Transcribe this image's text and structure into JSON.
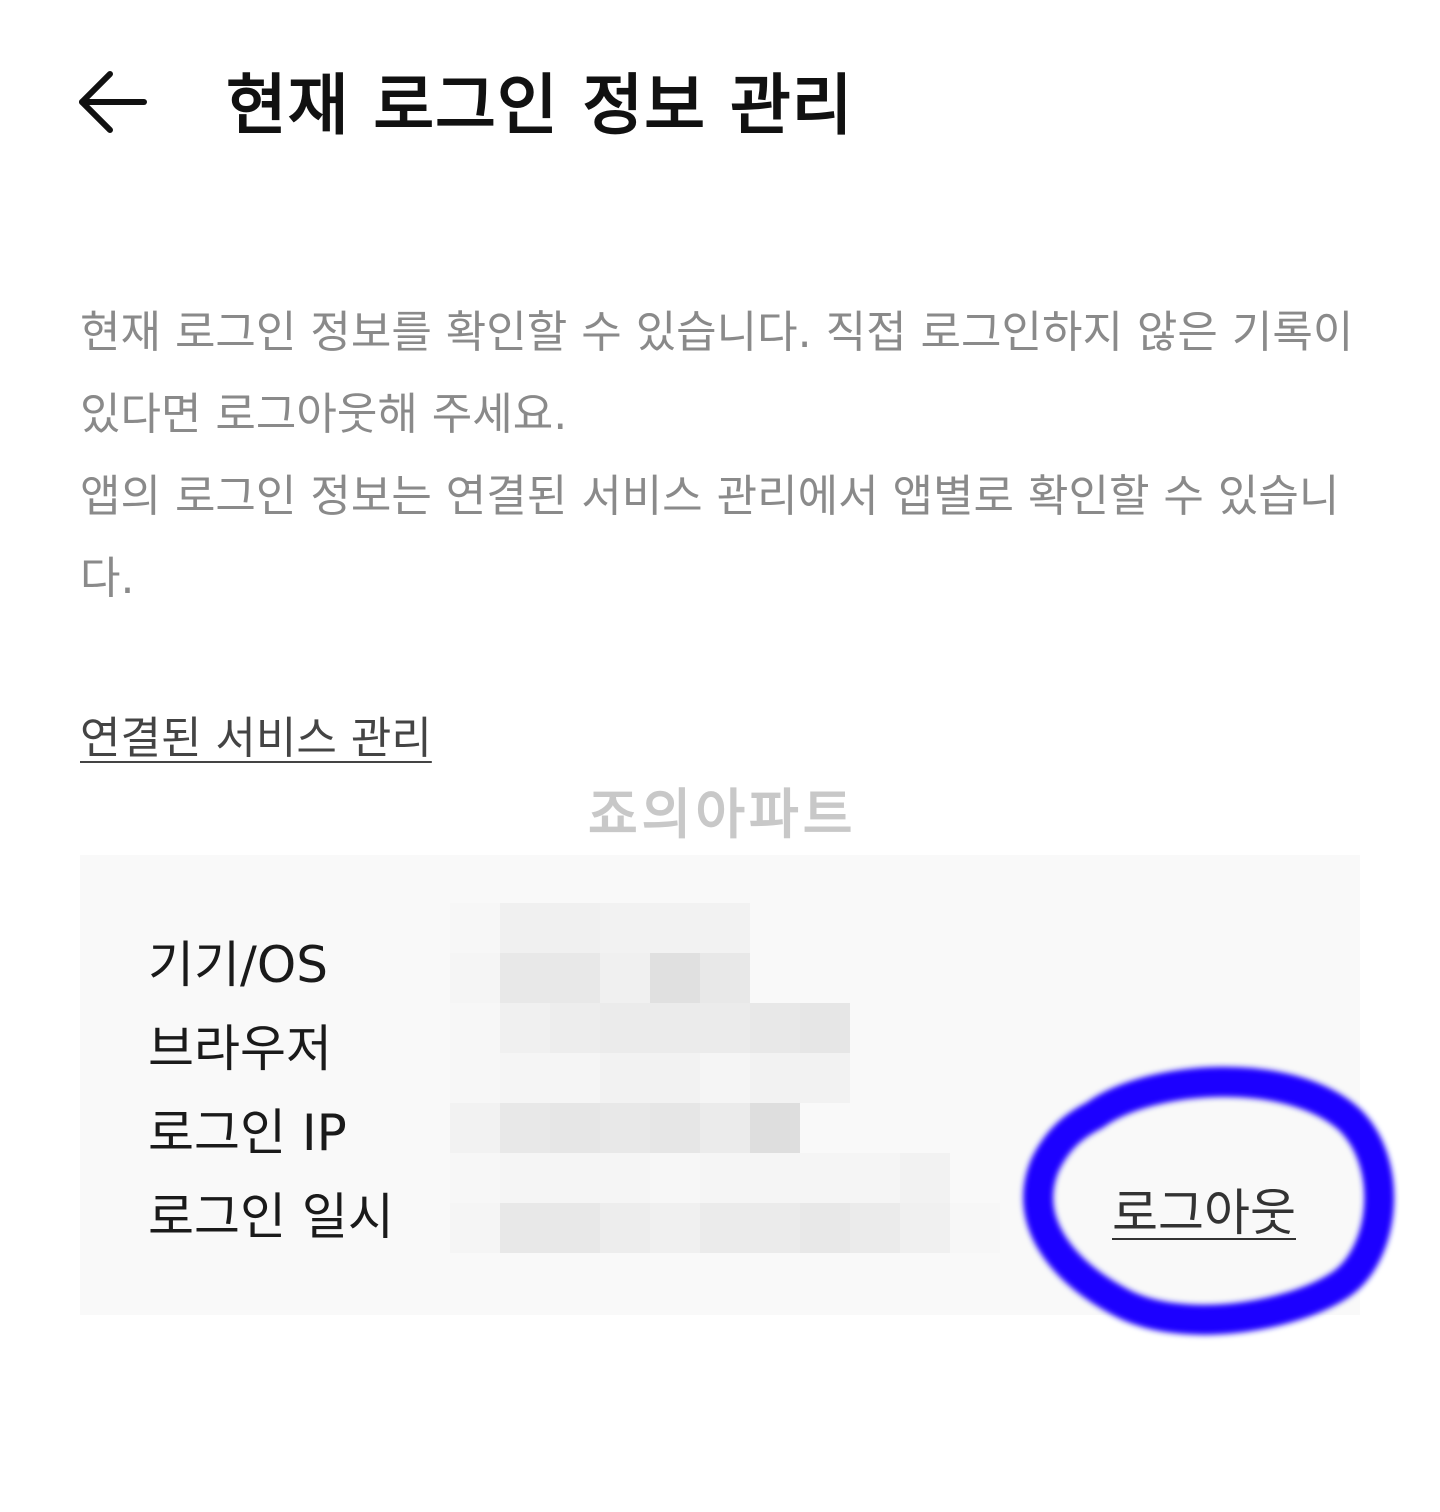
{
  "header": {
    "back_icon": "arrow-left-icon",
    "title": "현재 로그인 정보 관리"
  },
  "description": {
    "line1": "현재 로그인 정보를 확인할 수 있습니다. 직접 로그인하지 않은 기록이 있다면 로그아웃해 주세요.",
    "line2": "앱의 로그인 정보는 연결된 서비스 관리에서 앱별로 확인할 수 있습니다."
  },
  "connected_services_link": "연결된 서비스 관리",
  "watermark": "죠의아파트",
  "session": {
    "labels": {
      "device": "기기/OS",
      "browser": "브라우저",
      "ip": "로그인 IP",
      "time": "로그인 일시"
    },
    "logout_label": "로그아웃"
  },
  "colors": {
    "highlight": "#1f00ff",
    "card_background": "#f9f9f9",
    "description_text": "#8a8a8a"
  }
}
